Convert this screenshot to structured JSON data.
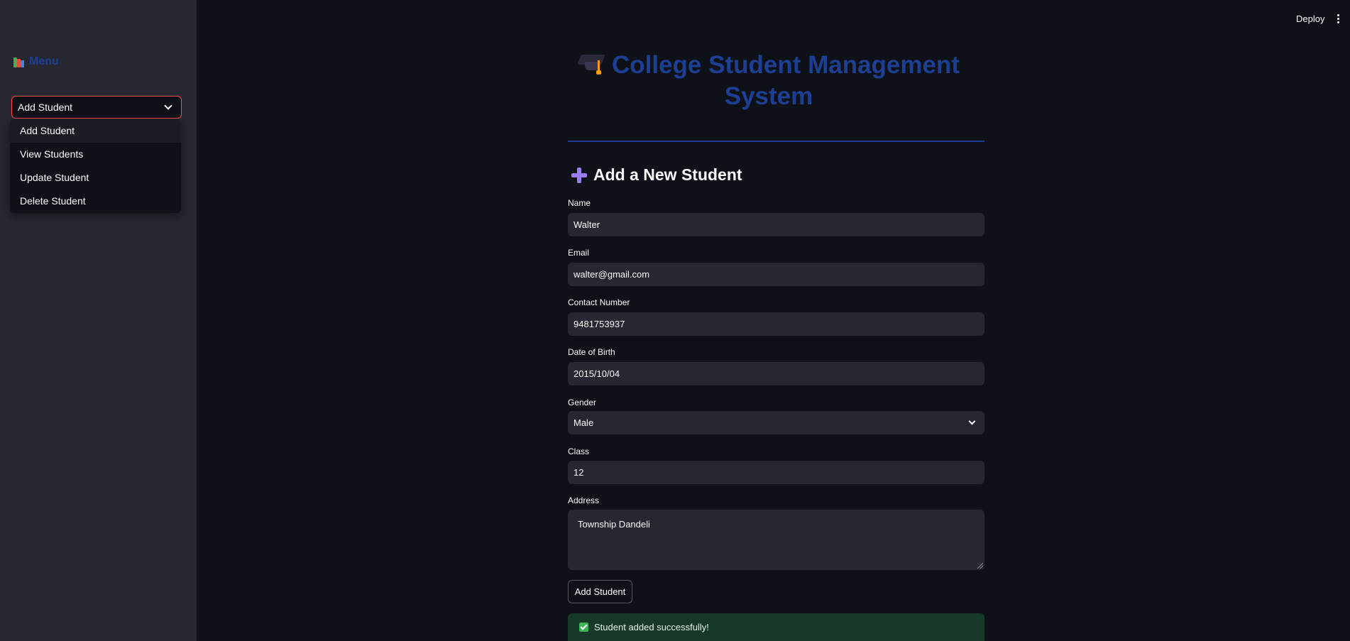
{
  "header": {
    "deploy_label": "Deploy"
  },
  "sidebar": {
    "title": "Menu",
    "select": {
      "value": "Add Student"
    },
    "options": [
      "Add Student",
      "View Students",
      "Update Student",
      "Delete Student"
    ]
  },
  "main": {
    "title_line1": "College Student Management",
    "title_line2": "System",
    "section_heading": "Add a New Student",
    "fields": {
      "name": {
        "label": "Name",
        "value": "Walter"
      },
      "email": {
        "label": "Email",
        "value": "walter@gmail.com"
      },
      "contact": {
        "label": "Contact Number",
        "value": "9481753937"
      },
      "dob": {
        "label": "Date of Birth",
        "value": "2015/10/04"
      },
      "gender": {
        "label": "Gender",
        "value": "Male"
      },
      "class": {
        "label": "Class",
        "value": "12"
      },
      "address": {
        "label": "Address",
        "value": "Township Dandeli"
      }
    },
    "submit_label": "Add Student",
    "success_message": "Student added successfully!"
  },
  "colors": {
    "accent": "#1c3f94",
    "focus_border": "#ff4b4b",
    "success_bg": "#173928"
  }
}
